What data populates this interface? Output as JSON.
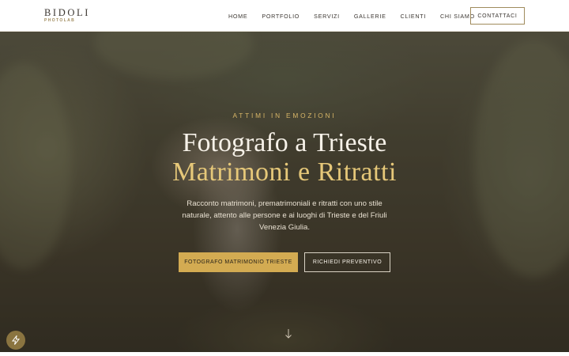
{
  "header": {
    "logo": {
      "main": "BIDOLI",
      "sub": "PHOTOLAB"
    },
    "nav": [
      {
        "label": "HOME"
      },
      {
        "label": "PORTFOLIO"
      },
      {
        "label": "SERVIZI"
      },
      {
        "label": "GALLERIE"
      },
      {
        "label": "CLIENTI"
      },
      {
        "label": "CHI SIAMO"
      }
    ],
    "cta_label": "CONTATTACI"
  },
  "hero": {
    "eyebrow": "ATTIMI IN EMOZIONI",
    "title_line1": "Fotografo a Trieste",
    "title_line2": "Matrimoni e Ritratti",
    "description": "Racconto matrimoni, prematrimoniali e ritratti con uno stile naturale, attento alle persone e ai luoghi di Trieste e del Friuli Venezia Giulia.",
    "primary_button": "FOTOGRAFO MATRIMONIO TRIESTE",
    "secondary_button": "RICHIEDI PREVENTIVO"
  },
  "icons": {
    "scroll": "arrow-down-icon",
    "fab": "lightning-icon"
  },
  "colors": {
    "accent": "#d3ab52",
    "gold_text": "#e6c879",
    "brand_dark": "#3b3631",
    "fab": "#8a7440"
  }
}
